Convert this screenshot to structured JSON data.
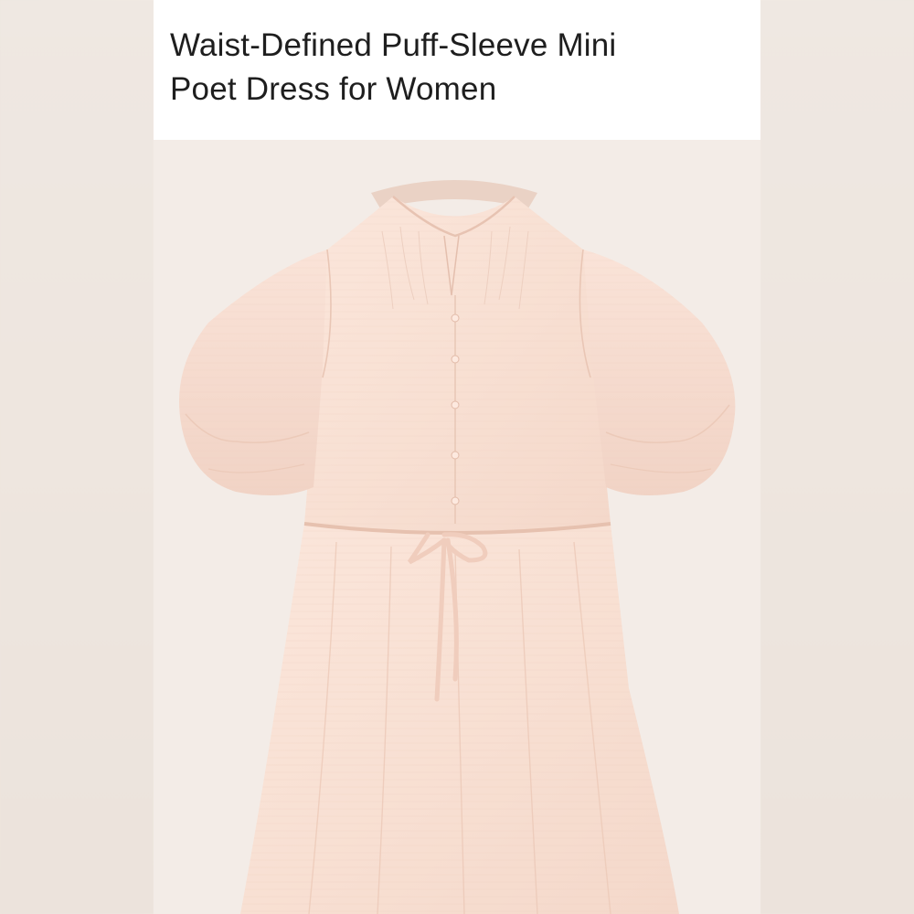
{
  "product": {
    "title_line_1": "Waist-Defined Puff-Sleeve Mini",
    "title_line_2": "Poet Dress for Women"
  },
  "colors": {
    "background": "#f3ece7",
    "title_card": "#ffffff",
    "dress": "#f9e2d6",
    "title_text": "#1e1e1e"
  }
}
